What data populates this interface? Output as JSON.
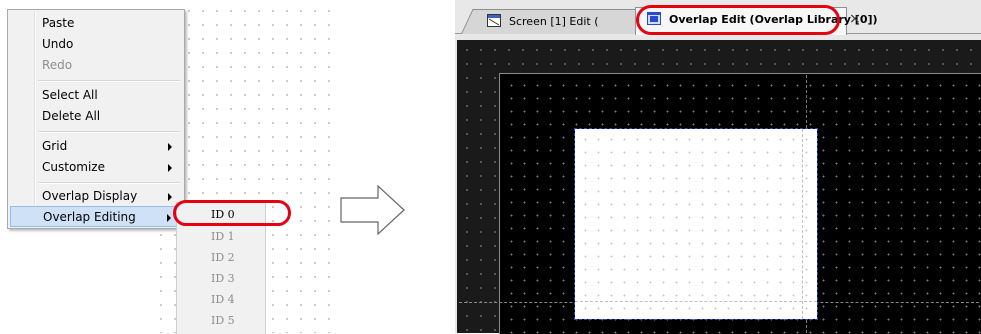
{
  "context_menu": {
    "items": [
      {
        "label": "Paste",
        "enabled": true
      },
      {
        "label": "Undo",
        "enabled": true
      },
      {
        "label": "Redo",
        "enabled": false
      },
      {
        "label": "Select All",
        "enabled": true
      },
      {
        "label": "Delete All",
        "enabled": true
      },
      {
        "label": "Grid",
        "enabled": true,
        "submenu": true
      },
      {
        "label": "Customize",
        "enabled": true,
        "submenu": true
      },
      {
        "label": "Overlap Display",
        "enabled": true,
        "submenu": true
      },
      {
        "label": "Overlap Editing",
        "enabled": true,
        "submenu": true,
        "highlighted": true
      }
    ]
  },
  "submenu": {
    "items": [
      {
        "label": "ID 0",
        "enabled": true
      },
      {
        "label": "ID 1",
        "enabled": false
      },
      {
        "label": "ID 2",
        "enabled": false
      },
      {
        "label": "ID 3",
        "enabled": false
      },
      {
        "label": "ID 4",
        "enabled": false
      },
      {
        "label": "ID 5",
        "enabled": false
      }
    ]
  },
  "editor": {
    "tabs": [
      {
        "label": "Screen [1] Edit (",
        "icon": "screen-icon",
        "active": false
      },
      {
        "label": "Overlap Edit (Overlap Library [0])",
        "icon": "overlap-library-icon",
        "active": true
      }
    ],
    "close_glyph": "×"
  },
  "colors": {
    "highlight_red": "#e60012",
    "menu_bg": "#f1f1f1",
    "menu_highlight": "#cfe1f6",
    "canvas_bg": "#000000",
    "selection_border": "#2a4bd1"
  }
}
